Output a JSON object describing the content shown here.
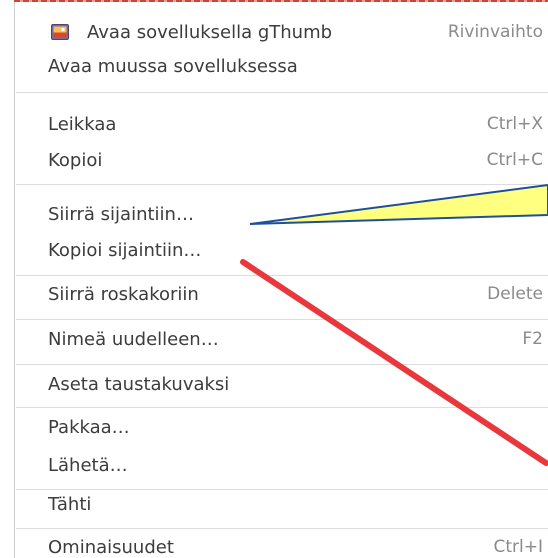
{
  "menu": {
    "items": [
      {
        "label": "Avaa sovelluksella gThumb",
        "accel": "Rivinvaihto",
        "icon": "gthumb-app-icon"
      },
      {
        "label": "Avaa muussa sovelluksessa",
        "accel": ""
      },
      {
        "label": "Leikkaa",
        "accel": "Ctrl+X"
      },
      {
        "label": "Kopioi",
        "accel": "Ctrl+C"
      },
      {
        "label": "Siirrä sijaintiin…",
        "accel": ""
      },
      {
        "label": "Kopioi sijaintiin…",
        "accel": ""
      },
      {
        "label": "Siirrä roskakoriin",
        "accel": "Delete"
      },
      {
        "label": "Nimeä uudelleen…",
        "accel": "F2"
      },
      {
        "label": "Aseta taustakuvaksi",
        "accel": ""
      },
      {
        "label": "Pakkaa…",
        "accel": ""
      },
      {
        "label": "Lähetä…",
        "accel": ""
      },
      {
        "label": "Tähti",
        "accel": ""
      },
      {
        "label": "Ominaisuudet",
        "accel": "Ctrl+I"
      }
    ]
  },
  "colors": {
    "callout_fill": "#ffff80",
    "callout_stroke": "#1f4e9c",
    "arrow_red": "#e8383b"
  }
}
